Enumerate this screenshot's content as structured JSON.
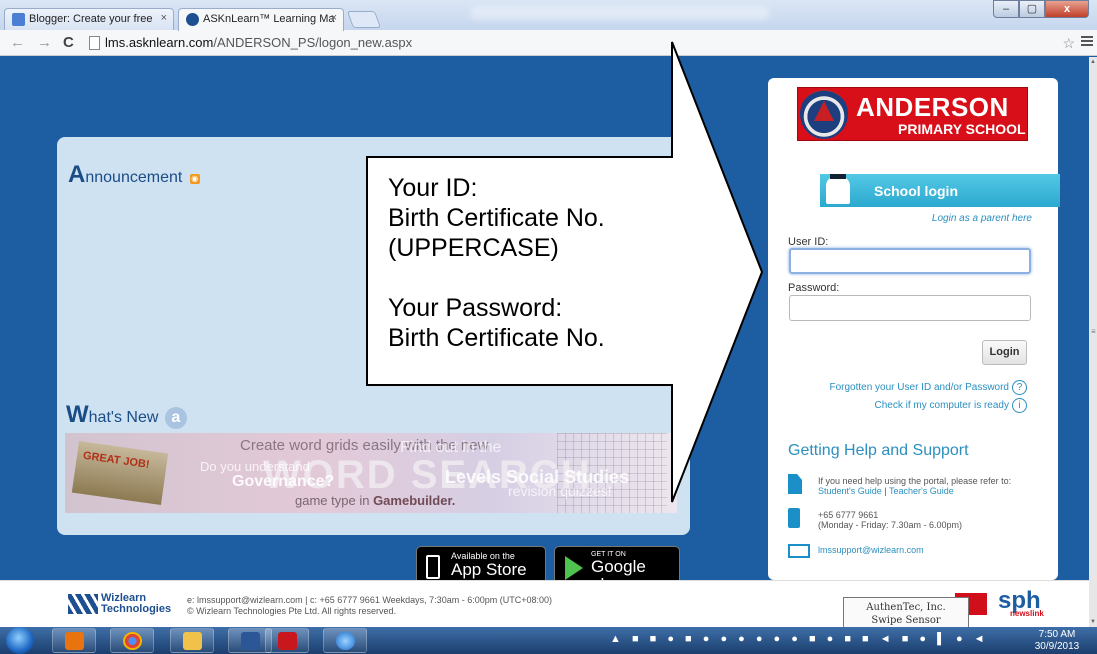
{
  "browser": {
    "tabs": [
      {
        "title": "Blogger: Create your free",
        "close": "×"
      },
      {
        "title": "ASKnLearn™ Learning Ma",
        "close": "×"
      }
    ],
    "window_buttons": [
      "–",
      "▢",
      "x"
    ],
    "url_host": "lms.asknlearn.com",
    "url_path": "/ANDERSON_PS/logon_new.aspx"
  },
  "content": {
    "announcement": {
      "big": "A",
      "rest": "nnouncement"
    },
    "whats_new": {
      "big": "W",
      "rest": "hat's New",
      "badge": "a"
    },
    "banner": {
      "line1": "Create word grids easily with the new",
      "line2": "Do you understand",
      "line3": "Governance?",
      "headline": "WORD SEARCH",
      "line4": "game type in",
      "line4_bold": "Gamebuilder.",
      "line5": "Find out in the",
      "line6": "Levels Social Studies",
      "line7": "revision quizzes!",
      "sign": "GREAT JOB!"
    },
    "app_store": {
      "small": "Available on the",
      "big": "App Store"
    },
    "google_play": {
      "small": "GET IT ON",
      "big": "Google play"
    }
  },
  "callout": {
    "lines": [
      "Your ID:",
      "Birth Certificate No.",
      "(UPPERCASE)",
      "",
      "Your Password:",
      "Birth Certificate No."
    ]
  },
  "login": {
    "school_line1": "ANDERSON",
    "school_line2": "PRIMARY SCHOOL",
    "school_login_label": "School login",
    "parent_link": "Login as a parent here",
    "user_id_label": "User ID:",
    "password_label": "Password:",
    "user_id_value": "",
    "password_value": "",
    "login_button": "Login",
    "forgot_link": "Forgotten your User ID and/or Password",
    "check_link": "Check if my computer is ready",
    "help_heading": "Getting Help and Support",
    "help_guide_text": "If you need help using the portal, please refer to:",
    "students_guide": "Student's Guide",
    "teachers_guide": "Teacher's Guide",
    "phone": "+65 6777 9661",
    "phone_hours": "(Monday - Friday: 7.30am - 6.00pm)",
    "email": "lmssupport@wizlearn.com"
  },
  "footer": {
    "company_line1": "Wizlearn",
    "company_line2": "Technologies",
    "contact": "e: lmssupport@wizlearn.com | c: +65 6777 9661 Weekdays, 7:30am - 6:00pm (UTC+08:00)",
    "copyright": "© Wizlearn Technologies Pte Ltd. All rights reserved.",
    "partner_sph": "sph",
    "partner_newslink": "newslink"
  },
  "tooltip": {
    "line1": "AuthenTec, Inc.",
    "line2": "Swipe Sensor Navigation"
  },
  "taskbar": {
    "time": "7:50 AM",
    "date": "30/9/2013"
  }
}
